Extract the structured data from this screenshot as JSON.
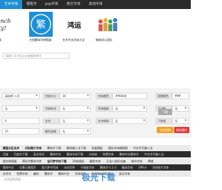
{
  "nav": {
    "tabs": [
      {
        "label": "艺术字体",
        "active": true
      },
      {
        "label": "钢笔字",
        "active": false
      },
      {
        "label": "psp字体",
        "active": false
      },
      {
        "label": "英文字体",
        "active": false
      },
      {
        "label": "其他字体",
        "active": false
      }
    ]
  },
  "thumbs": [
    {
      "caption": "下载"
    },
    {
      "caption": "古钱繁体字转换器"
    },
    {
      "caption": "艺术书法字体大全"
    },
    {
      "caption": "微商初心团队"
    }
  ],
  "search": {
    "placeholder": "请输入文字后点击查看效果字"
  },
  "controls": {
    "font_select": "请选择 二月",
    "font_size_label": "字体大小",
    "font_size_value": "30",
    "font_color_label": "字体颜色",
    "font_color_value": "#ff0000",
    "bg_color_label": "背景颜色",
    "bg_color_value": "ffffff",
    "row2_sel1": "无",
    "row2_label2": "字体样式",
    "row2_sel2": "无",
    "row2_label3": "字体粗体",
    "row2_sel3": "无",
    "row2_label4": "下边框",
    "row2_sel4": "无",
    "row3_val1": "0",
    "row3_label2": "文字",
    "row3_sel2": "无",
    "row3_label3": "文字倾斜",
    "row3_sel3": "无",
    "row3_label4": "下划线",
    "row3_sel4": "无",
    "row4_val1": "15",
    "row4_label2": "颜色滤镜",
    "row4_sel2": "无",
    "download_btn": "下载",
    "generate_btn": "生成效果",
    "save_btn": "保存图片"
  },
  "tags": {
    "row1": [
      "硬盘分区合并",
      "识别图片字体",
      "繁体字下载",
      "繁体输入法下载",
      "有爱模板",
      "国际字体模版图",
      "中文字写输入法"
    ],
    "row2": [
      "百度",
      "百度字下载",
      "英文系列",
      "繁体中文",
      "繁体字体下载",
      "大枝体",
      "免费字体",
      "繁体中文繁体字",
      "中文字写输入法"
    ],
    "row3": [
      "图名转换器",
      "原形字繁体字转",
      "宝可梦字体下载",
      "16纯相册",
      "最鲜字体",
      "天龙八部好宝箱",
      "城市字体",
      "牌楼"
    ],
    "row4": [
      "简体中文",
      "红繁元素相字",
      "复大梦书写体",
      "冰封世界",
      "千图变字体",
      "繁体字-1.1.0",
      "精选字体",
      "Office",
      "识别图片字体"
    ],
    "row5": [
      "艺术字",
      "免费字体",
      "编码",
      "繁体字",
      "繁体中文",
      "字体软件",
      "艺术字LOGO设计",
      "英文字体"
    ]
  },
  "footer": {
    "scroll_label": "点击回到顶部",
    "watermark": "极光下载"
  },
  "colors": {
    "nav_bg": "#2a2a2a",
    "nav_active": "#1e8fd4",
    "generate": "#f0a020",
    "save": "#e03c3c"
  }
}
